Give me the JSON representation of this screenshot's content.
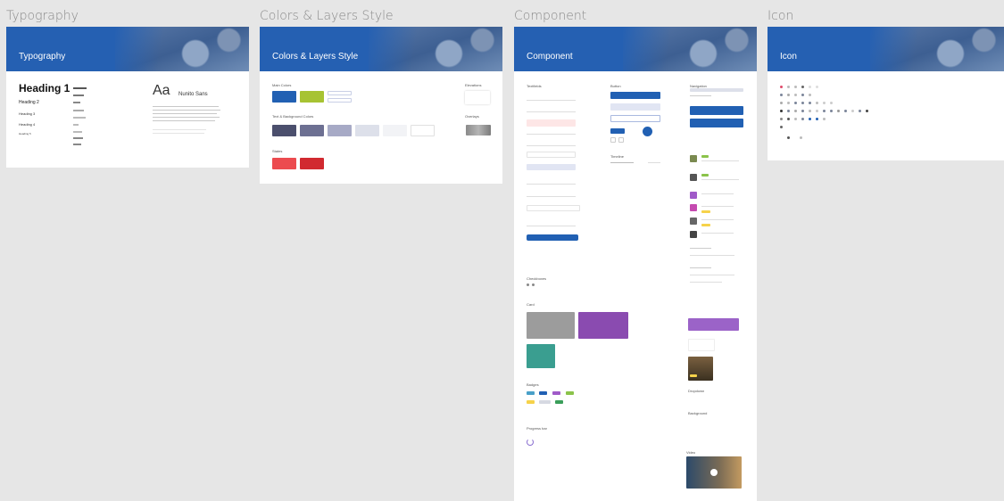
{
  "frames": {
    "typography": {
      "label": "Typography",
      "header": "Typography",
      "headings": [
        "Heading 1",
        "Heading 2",
        "Heading 3",
        "Heading 4",
        "Heading 5"
      ],
      "sample_glyph": "Aa",
      "font_name": "Nunito Sans"
    },
    "colors": {
      "label": "Colors & Layers Style",
      "header": "Colors & Layers Style",
      "main_colors_label": "Main Colors",
      "text_bg_label": "Text & Background Colors",
      "states_label": "States",
      "elevations_label": "Elevations",
      "overlays_label": "Overlays",
      "main_colors": [
        "#2160b3",
        "#a7c333"
      ],
      "text_bg_colors": [
        "#4b4f6d",
        "#6d7092",
        "#a7aac6",
        "#dde0ea",
        "#f2f3f6",
        "#ffffff"
      ],
      "state_colors": [
        "#ec4b4f",
        "#d12a30"
      ]
    },
    "component": {
      "label": "Component",
      "header": "Component",
      "sections": {
        "textfields": "Textfields",
        "button": "Button",
        "navigation": "Navigation",
        "timeline": "Timeline",
        "checkbox": "Checkboxes",
        "card": "Card",
        "badges": "Badges",
        "progress": "Progress bar",
        "dropdown": "Dropdown",
        "background": "Background",
        "video": "Video"
      },
      "button_colors": [
        "#2160b3",
        "#e1e5f3"
      ],
      "card_colors": [
        "#9c9c9c",
        "#8a4bb0",
        "#3a9e90",
        "#9b63c8"
      ],
      "badge_colors": [
        "#49a0c8",
        "#2160b3",
        "#a05ac8",
        "#8bc34a",
        "#f6d24a",
        "#d6d9e2",
        "#3a9e5a"
      ]
    },
    "icon": {
      "label": "Icon",
      "header": "Icon"
    }
  }
}
